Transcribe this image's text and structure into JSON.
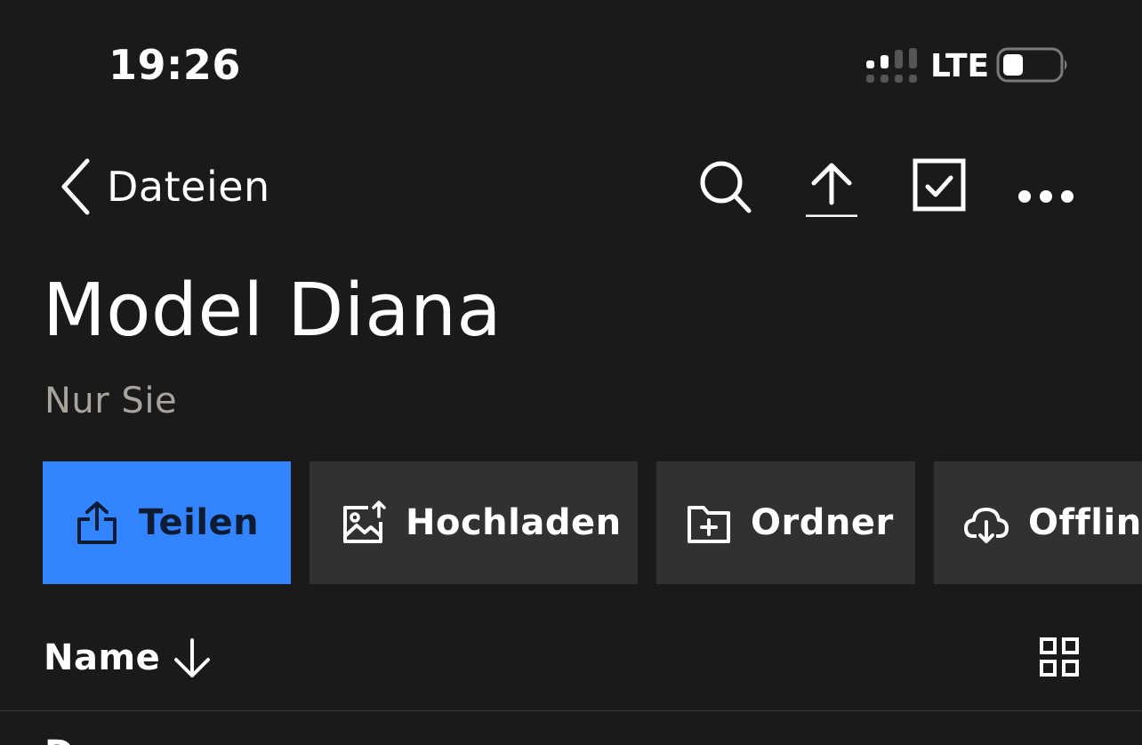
{
  "status_bar": {
    "time": "19:26",
    "network": "LTE",
    "icons": [
      "signal-icon",
      "battery-icon"
    ]
  },
  "nav": {
    "back_label": "Dateien",
    "icons": [
      "chevron-left-icon",
      "search-icon",
      "upload-icon",
      "checkbox-icon",
      "more-icon"
    ]
  },
  "folder": {
    "title": "Model Diana",
    "subtitle": "Nur Sie"
  },
  "actions": [
    {
      "label": "Teilen",
      "icon": "share-icon"
    },
    {
      "label": "Hochladen",
      "icon": "photo-upload-icon"
    },
    {
      "label": "Ordner",
      "icon": "folder-add-icon"
    },
    {
      "label": "Offline",
      "icon": "cloud-download-icon"
    }
  ],
  "list": {
    "sort_label": "Name",
    "sort_icon": "arrow-down-icon",
    "view_icon": "grid-view-icon",
    "first_row_text": "D"
  },
  "colors": {
    "background": "#1b1a1a",
    "primary_button": "#3385ff",
    "secondary_button": "#323131",
    "subtitle": "#a8a39d"
  }
}
